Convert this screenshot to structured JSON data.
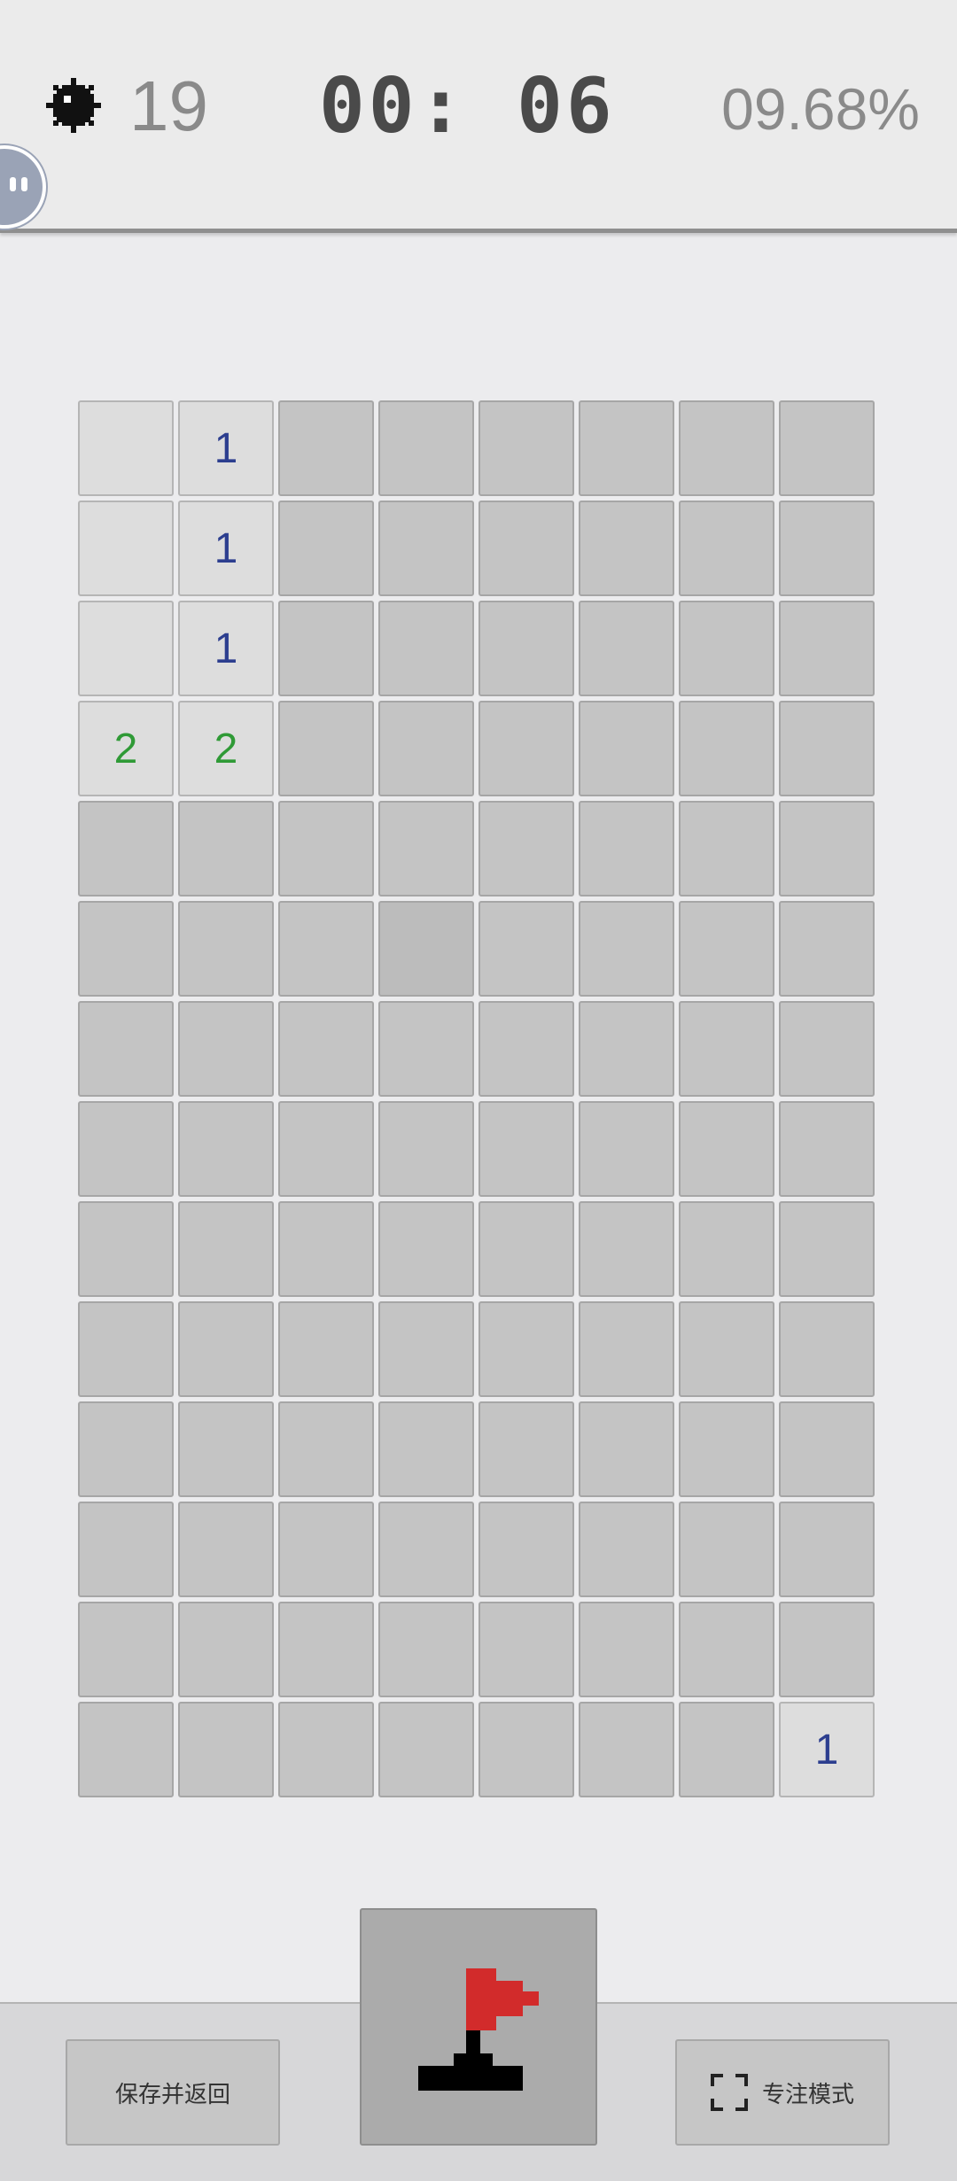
{
  "header": {
    "mines_remaining": "19",
    "timer": "00: 06",
    "progress_percent": "09.68%"
  },
  "board": {
    "cols": 8,
    "rows": 14,
    "cells": [
      [
        "",
        "1",
        null,
        null,
        null,
        null,
        null,
        null
      ],
      [
        "",
        "1",
        null,
        null,
        null,
        null,
        null,
        null
      ],
      [
        "",
        "1",
        null,
        null,
        null,
        null,
        null,
        null
      ],
      [
        "2",
        "2",
        null,
        null,
        null,
        null,
        null,
        null
      ],
      [
        null,
        null,
        null,
        null,
        null,
        null,
        null,
        null
      ],
      [
        null,
        null,
        null,
        null,
        null,
        null,
        null,
        null
      ],
      [
        null,
        null,
        null,
        null,
        null,
        null,
        null,
        null
      ],
      [
        null,
        null,
        null,
        null,
        null,
        null,
        null,
        null
      ],
      [
        null,
        null,
        null,
        null,
        null,
        null,
        null,
        null
      ],
      [
        null,
        null,
        null,
        null,
        null,
        null,
        null,
        null
      ],
      [
        null,
        null,
        null,
        null,
        null,
        null,
        null,
        null
      ],
      [
        null,
        null,
        null,
        null,
        null,
        null,
        null,
        null
      ],
      [
        null,
        null,
        null,
        null,
        null,
        null,
        null,
        null
      ],
      [
        null,
        null,
        null,
        null,
        null,
        null,
        null,
        "1"
      ]
    ],
    "pressed_cell": [
      5,
      3
    ],
    "number_colors": {
      "1": "#2c3e8f",
      "2": "#2f9a36"
    }
  },
  "footer": {
    "save_label": "保存并返回",
    "focus_label": "专注模式",
    "flag_icon": "flag-icon",
    "focus_icon": "fullscreen-icon"
  },
  "colors": {
    "flag_red": "#d22b2b",
    "unrevealed": "#c4c4c4",
    "revealed": "#dddddd"
  }
}
